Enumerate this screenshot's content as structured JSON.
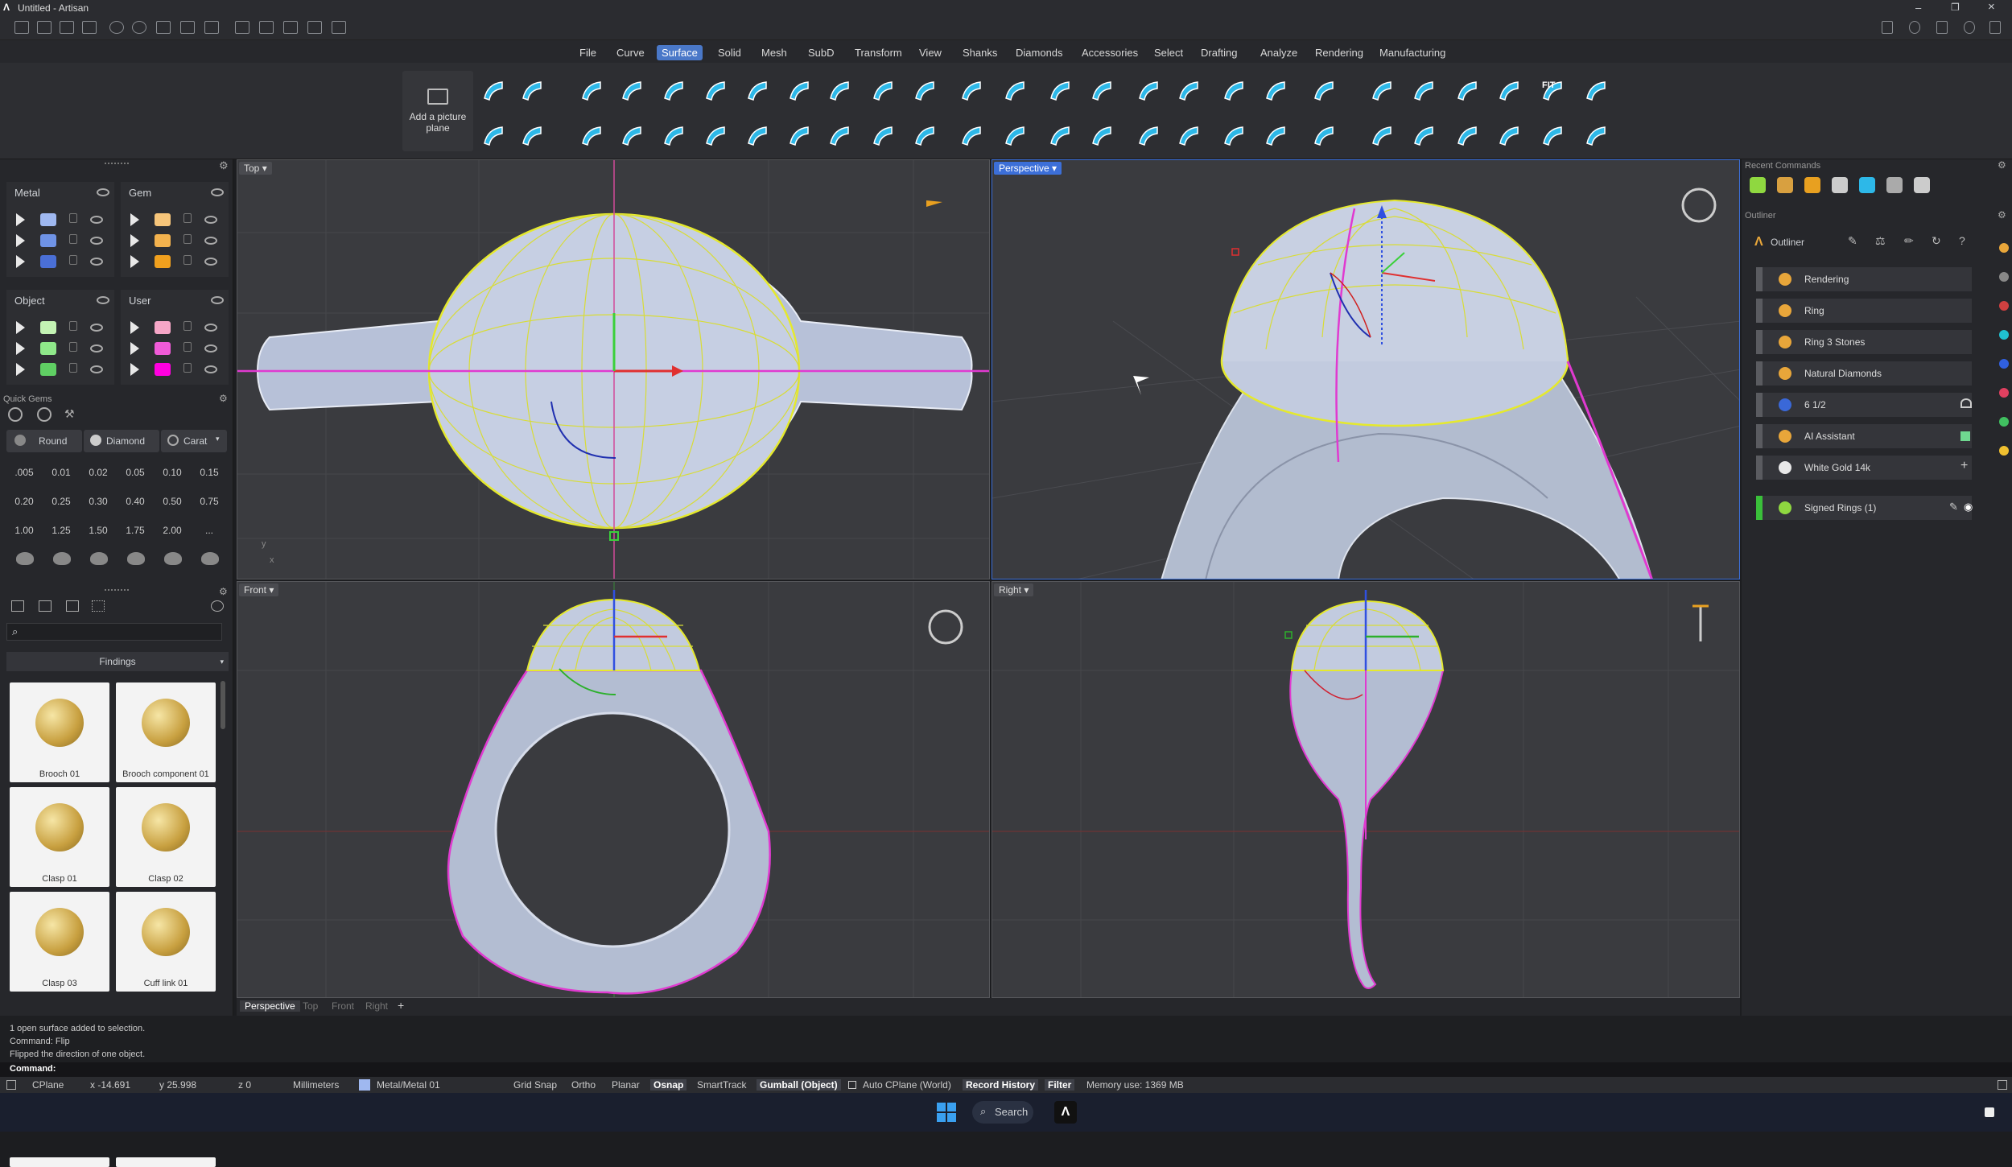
{
  "app": {
    "title": "Untitled - Artisan"
  },
  "menus": [
    "File",
    "Curve",
    "Surface",
    "Solid",
    "Mesh",
    "SubD",
    "Transform",
    "View",
    "Shanks",
    "Diamonds",
    "Accessories",
    "Select",
    "Drafting",
    "Analyze",
    "Rendering",
    "Manufacturing"
  ],
  "ribbon": {
    "picture_plane_line1": "Add a picture",
    "picture_plane_line2": "plane",
    "fit_label": "FIT"
  },
  "layers": {
    "metal": "Metal",
    "gem": "Gem",
    "object": "Object",
    "user": "User",
    "metal_colors": [
      "#9fb8f0",
      "#6f93e6",
      "#4a6fd6"
    ],
    "gem_colors": [
      "#f6c57a",
      "#f3b24e",
      "#f0a01e"
    ],
    "object_colors": [
      "#c3f3b4",
      "#8fe88a",
      "#5fcf63"
    ],
    "user_colors": [
      "#f6a6c7",
      "#f05bd8",
      "#ff00e0"
    ]
  },
  "quick_gems": {
    "title": "Quick Gems",
    "round": "Round",
    "diamond": "Diamond",
    "carat": "Carat",
    "values": [
      ".005",
      "0.01",
      "0.02",
      "0.05",
      "0.10",
      "0.15",
      "0.20",
      "0.25",
      "0.30",
      "0.40",
      "0.50",
      "0.75",
      "1.00",
      "1.25",
      "1.50",
      "1.75",
      "2.00",
      "..."
    ]
  },
  "findings": {
    "title": "Findings",
    "search_placeholder": "",
    "items": [
      "Brooch 01",
      "Brooch component 01",
      "Clasp 01",
      "Clasp 02",
      "Clasp 03",
      "Cuff link 01"
    ]
  },
  "viewports": {
    "top": "Top",
    "perspective": "Perspective",
    "front": "Front",
    "right": "Right"
  },
  "viewport_tabs": [
    "Perspective",
    "Top",
    "Front",
    "Right"
  ],
  "recent_commands": {
    "title": "Recent Commands"
  },
  "outliner": {
    "title": "Outliner",
    "header": "Outliner",
    "items": [
      {
        "label": "Rendering",
        "color": "#e8a63a"
      },
      {
        "label": "Ring",
        "color": "#e8a63a"
      },
      {
        "label": "Ring 3 Stones",
        "color": "#e8a63a"
      },
      {
        "label": "Natural Diamonds",
        "color": "#e8a63a"
      },
      {
        "label": "6 1/2",
        "color": "#3a68d8"
      },
      {
        "label": "AI Assistant",
        "color": "#e8a63a"
      },
      {
        "label": "White Gold 14k",
        "color": "#e8e8e8"
      }
    ],
    "signed": "Signed Rings (1)"
  },
  "command": {
    "history": [
      "1 open surface added to selection.",
      "Command: Flip",
      "Flipped the direction of one object."
    ],
    "prompt": "Command:",
    "value": ""
  },
  "status": {
    "cplane": "CPlane",
    "x": "x -14.691",
    "y": "y 25.998",
    "z": "z 0",
    "units": "Millimeters",
    "layer": "Metal/Metal 01",
    "grid_snap": "Grid Snap",
    "ortho": "Ortho",
    "planar": "Planar",
    "osnap": "Osnap",
    "smarttrack": "SmartTrack",
    "gumball": "Gumball (Object)",
    "auto_cplane": "Auto CPlane (World)",
    "record_history": "Record History",
    "filter": "Filter",
    "memory": "Memory use: 1369 MB"
  },
  "taskbar": {
    "search": "Search"
  }
}
